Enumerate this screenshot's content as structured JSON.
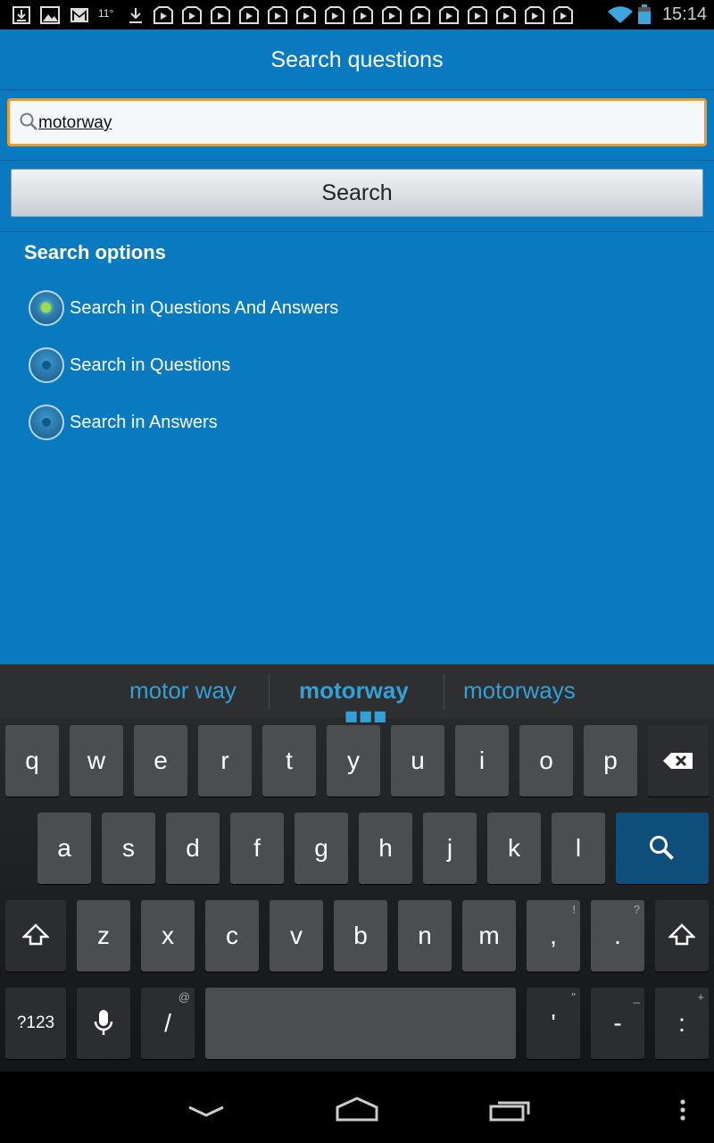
{
  "status_bar": {
    "time": "15:14",
    "temperature": "11°"
  },
  "app": {
    "title": "Search questions",
    "search_query": "motorway",
    "search_button_label": "Search",
    "options_heading": "Search options",
    "options": [
      {
        "label": "Search in Questions And Answers",
        "checked": true
      },
      {
        "label": "Search in Questions",
        "checked": false
      },
      {
        "label": "Search in Answers",
        "checked": false
      }
    ]
  },
  "keyboard": {
    "suggestions": [
      "motor way",
      "motorway",
      "motorways"
    ],
    "row1": [
      "q",
      "w",
      "e",
      "r",
      "t",
      "y",
      "u",
      "i",
      "o",
      "p"
    ],
    "row2": [
      "a",
      "s",
      "d",
      "f",
      "g",
      "h",
      "j",
      "k",
      "l"
    ],
    "row3": [
      "z",
      "x",
      "c",
      "v",
      "b",
      "n",
      "m",
      ",",
      "."
    ],
    "row3_hints": [
      "",
      "",
      "",
      "",
      "",
      "",
      "",
      "!",
      "?"
    ],
    "row4": {
      "symbols": "?123",
      "slash": "/",
      "slash_hint": "@",
      "apostrophe": "'",
      "apostrophe_hint": "\"",
      "dash": "-",
      "dash_hint": "_",
      "colon": ":",
      "colon_hint": "+"
    }
  }
}
